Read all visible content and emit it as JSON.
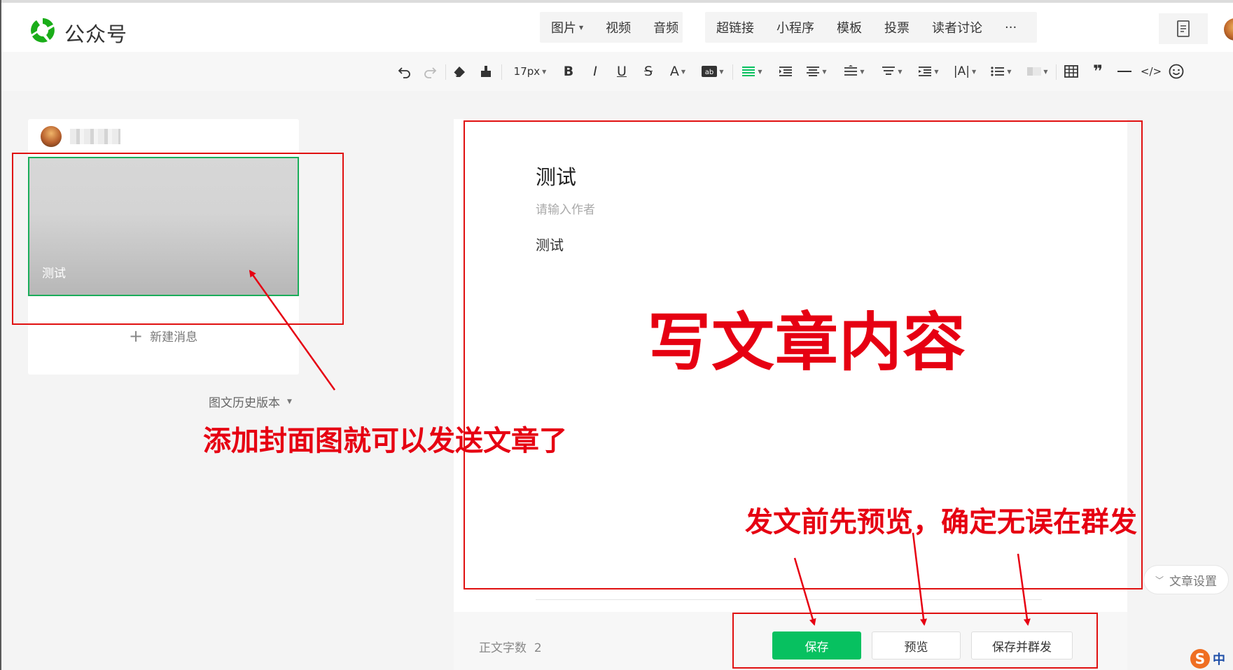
{
  "header": {
    "brand": "公众号",
    "tab_group_1": [
      {
        "label": "图片",
        "dropdown": true
      },
      {
        "label": "视频",
        "dropdown": false
      },
      {
        "label": "音频",
        "dropdown": false
      }
    ],
    "tab_group_2": [
      {
        "label": "超链接"
      },
      {
        "label": "小程序"
      },
      {
        "label": "模板"
      },
      {
        "label": "投票"
      },
      {
        "label": "读者讨论"
      },
      {
        "label": "···"
      }
    ]
  },
  "toolbar": {
    "font_size": "17px"
  },
  "sidebar": {
    "cover_title": "测试",
    "new_message": "新建消息",
    "history": "图文历史版本"
  },
  "article": {
    "title": "测试",
    "author_placeholder": "请输入作者",
    "body": "测试",
    "word_count_label": "正文字数",
    "word_count": "2"
  },
  "actions": {
    "save": "保存",
    "preview": "预览",
    "save_publish": "保存并群发",
    "settings": "文章设置"
  },
  "ime": {
    "label": "中"
  },
  "annotations": {
    "main": "写文章内容",
    "cover_hint": "添加封面图就可以发送文章了",
    "publish_hint": "发文前先预览，确定无误在群发"
  },
  "colors": {
    "accent": "#07c160",
    "annotation": "#e60012"
  }
}
